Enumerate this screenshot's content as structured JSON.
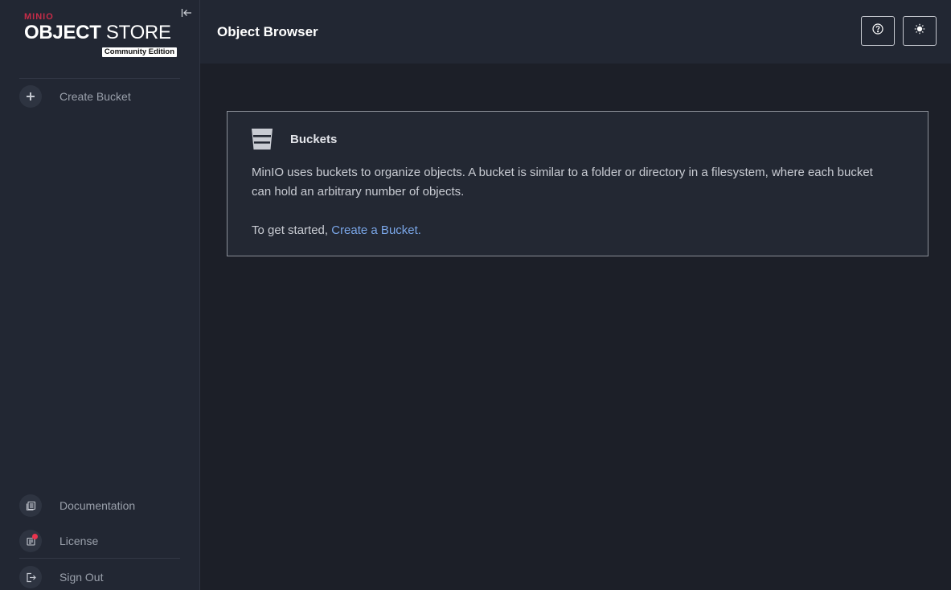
{
  "app": {
    "logo_brand": "MINIO",
    "logo_title_bold": "OBJECT",
    "logo_title_thin": " STORE",
    "logo_edition": "Community Edition"
  },
  "sidebar": {
    "collapse_icon": "collapse-left-icon",
    "top_items": [
      {
        "label": "Create Bucket",
        "icon": "plus-icon"
      }
    ],
    "bottom_items": [
      {
        "label": "Documentation",
        "icon": "documentation-icon"
      },
      {
        "label": "License",
        "icon": "license-icon",
        "badge_color": "#e8344e"
      },
      {
        "label": "Sign Out",
        "icon": "sign-out-icon"
      }
    ]
  },
  "header": {
    "title": "Object Browser",
    "help_icon": "help-icon",
    "theme_icon": "sun-icon"
  },
  "main": {
    "card": {
      "icon": "bucket-icon",
      "title": "Buckets",
      "description": "MinIO uses buckets to organize objects. A bucket is similar to a folder or directory in a filesystem, where each bucket can hold an arbitrary number of objects.",
      "cta_prefix": "To get started, ",
      "cta_link": "Create a Bucket."
    }
  },
  "colors": {
    "sidebar_bg": "#222733",
    "content_bg": "#1c1f28",
    "brand_red": "#c72c48",
    "link": "#7aa6e8"
  }
}
